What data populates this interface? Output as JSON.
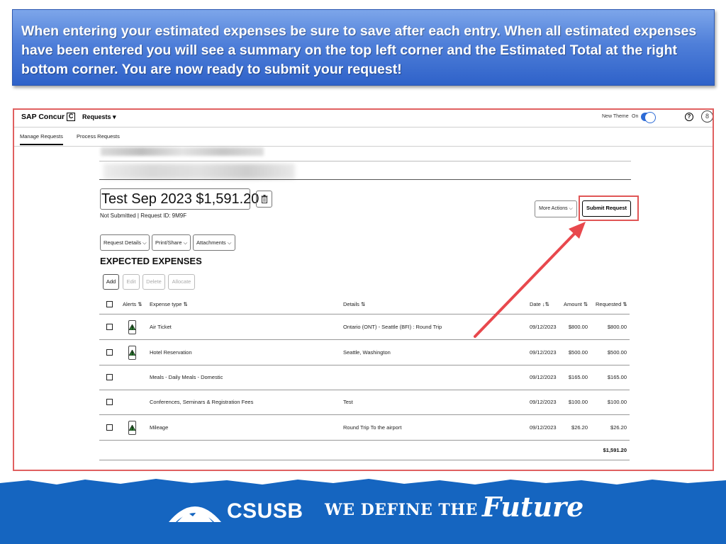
{
  "banner": {
    "text": "When entering your estimated expenses be sure to save after each entry. When all estimated expenses have been entered you will see a summary on the top left corner and the Estimated Total at the right bottom corner. You are now ready to submit your request!"
  },
  "app": {
    "brand": "SAP Concur",
    "brand_mark": "C",
    "menu": "Requests ▾",
    "new_theme_label": "New Theme",
    "theme_state": "On",
    "help_glyph": "?",
    "avatar_glyph": "8"
  },
  "subnav": {
    "manage": "Manage Requests",
    "process": "Process Requests"
  },
  "request": {
    "title": "Test Sep 2023 $1,591.20",
    "status": "Not Submitted  |  Request ID: 9M9F",
    "more_actions": "More Actions ⌵",
    "submit": "Submit Request"
  },
  "tabs": {
    "details": "Request Details ⌵",
    "print": "Print/Share ⌵",
    "attachments": "Attachments ⌵"
  },
  "section_title": "EXPECTED EXPENSES",
  "actions": {
    "add": "Add",
    "edit": "Edit",
    "delete": "Delete",
    "allocate": "Allocate"
  },
  "table": {
    "headers": {
      "alerts": "Alerts ⇅",
      "type": "Expense type ⇅",
      "details": "Details ⇅",
      "date": "Date ↓⇅",
      "amount": "Amount ⇅",
      "requested": "Requested ⇅"
    },
    "rows": [
      {
        "alert": true,
        "type": "Air Ticket",
        "details": "Ontario (ONT) - Seattle (BFI) : Round Trip",
        "date": "09/12/2023",
        "amount": "$800.00",
        "requested": "$800.00"
      },
      {
        "alert": true,
        "type": "Hotel Reservation",
        "details": "Seattle, Washington",
        "date": "09/12/2023",
        "amount": "$500.00",
        "requested": "$500.00"
      },
      {
        "alert": false,
        "type": "Meals - Daily Meals - Domestic",
        "details": "",
        "date": "09/12/2023",
        "amount": "$165.00",
        "requested": "$165.00"
      },
      {
        "alert": false,
        "type": "Conferences, Seminars & Registration Fees",
        "details": "Test",
        "date": "09/12/2023",
        "amount": "$100.00",
        "requested": "$100.00"
      },
      {
        "alert": true,
        "type": "Mileage",
        "details": "Round Trip To the airport",
        "date": "09/12/2023",
        "amount": "$26.20",
        "requested": "$26.20"
      }
    ],
    "total": "$1,591.20"
  },
  "footer": {
    "logo_text": "CSUSB",
    "tagline": "WE DEFINE THE",
    "tagline_script": "Future"
  },
  "colors": {
    "banner_blue": "#3b6fd1",
    "highlight_red": "#e05555",
    "footer_blue": "#1565c0"
  }
}
